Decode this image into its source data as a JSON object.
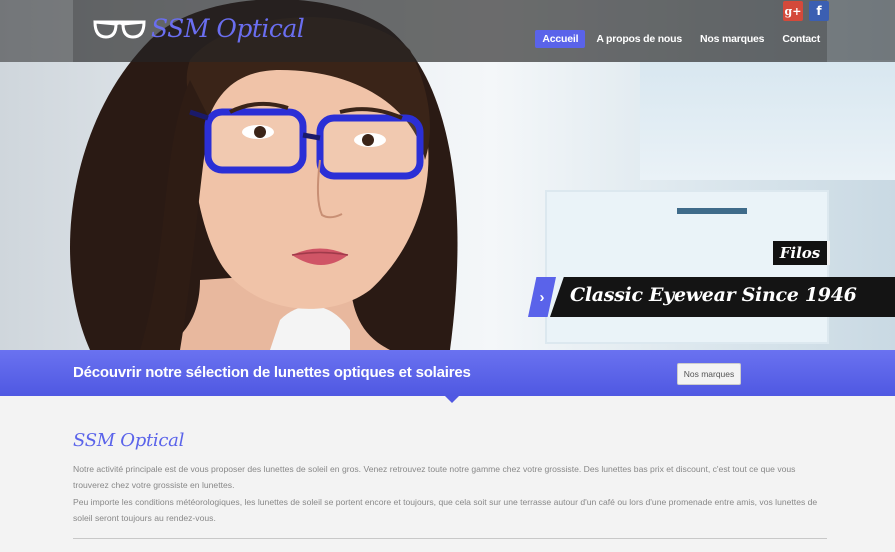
{
  "header": {
    "logo_text": "SSM Optical",
    "nav": [
      {
        "label": "Accueil",
        "active": true
      },
      {
        "label": "A propos de nous",
        "active": false
      },
      {
        "label": "Nos marques",
        "active": false
      },
      {
        "label": "Contact",
        "active": false
      }
    ],
    "social": {
      "gplus": "g+",
      "facebook": "f"
    }
  },
  "slider": {
    "caption_small": "Filos",
    "caption_big": "Classic Eyewear Since 1946",
    "arrow": "›"
  },
  "band": {
    "text": "Découvrir notre sélection de lunettes optiques et solaires",
    "button": "Nos marques"
  },
  "content": {
    "title": "SSM Optical",
    "p1": "Notre activité principale est de vous proposer des lunettes de soleil en gros. Venez retrouvez toute notre gamme chez votre grossiste. Des lunettes bas prix et discount, c'est tout ce que vous trouverez chez votre grossiste en lunettes.",
    "p2": "Peu importe les conditions météorologiques, les lunettes de soleil se portent encore et toujours, que cela soit sur une terrasse autour d'un café ou lors d'une promenade entre amis, vos lunettes de soleil seront toujours au rendez-vous."
  },
  "colors": {
    "accent": "#5a63ea",
    "dark": "#141414"
  }
}
